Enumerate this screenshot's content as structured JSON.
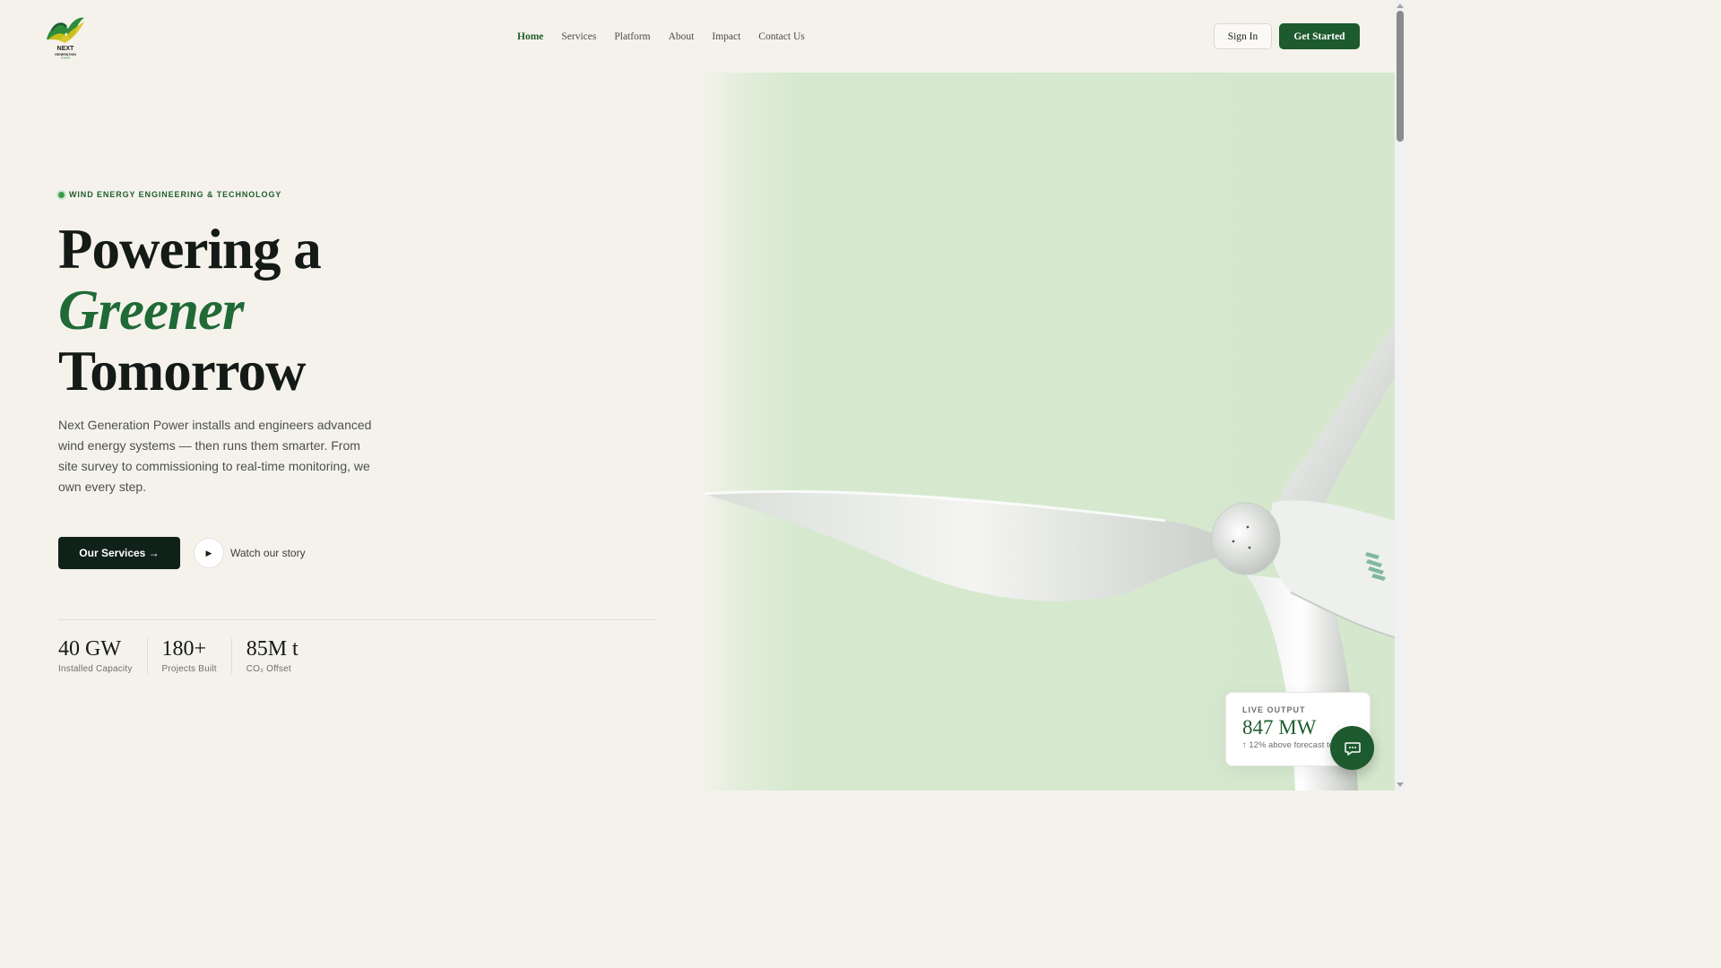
{
  "header": {
    "logo_alt": "NEXT GENERATION POWER",
    "nav": [
      "Home",
      "Services",
      "Platform",
      "About",
      "Impact",
      "Contact Us"
    ],
    "active_nav": "Home",
    "sign_in": "Sign In",
    "get_started": "Get Started"
  },
  "hero": {
    "eyebrow": "WIND ENERGY ENGINEERING & TECHNOLOGY",
    "headline_line1": "Powering a",
    "headline_line2": "Greener",
    "headline_line3": "Tomorrow",
    "lead": "Next Generation Power installs and engineers advanced wind energy systems — then runs them smarter. From site survey to commissioning to real-time monitoring, we own every step.",
    "cta_primary": "Our Services →",
    "cta_secondary": "Watch our story",
    "play_glyph": "▶"
  },
  "stats": [
    {
      "value": "40 GW",
      "label": "Installed Capacity"
    },
    {
      "value": "180+",
      "label": "Projects Built"
    },
    {
      "value": "85M t",
      "label": "CO₂ Offset"
    }
  ],
  "live_output": {
    "label": "LIVE OUTPUT",
    "value": "847 MW",
    "note": "↑ 12% above forecast today"
  },
  "icons": {
    "chat": "chat-bubble-icon",
    "play": "play-icon"
  },
  "colors": {
    "brand_green": "#1d5a2e",
    "accent_green": "#1f6a36",
    "page_bg": "#f5f2ec",
    "hero_bg": "#d5e8ce"
  }
}
